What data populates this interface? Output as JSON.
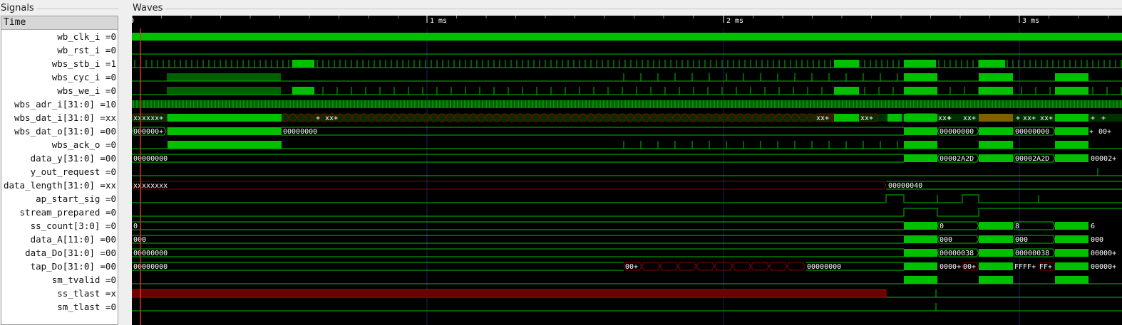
{
  "panels": {
    "signals_title": "Signals",
    "waves_title": "Waves"
  },
  "signals": {
    "header": "Time",
    "rows": [
      "wb_clk_i =0",
      "wb_rst_i =0",
      "wbs_stb_i =1",
      "wbs_cyc_i =0",
      "wbs_we_i =0",
      "wbs_adr_i[31:0] =10",
      "wbs_dat_i[31:0] =xx",
      "wbs_dat_o[31:0] =00",
      "wbs_ack_o =0",
      "data_y[31:0] =00",
      "y_out_request =0",
      "data_length[31:0] =xx",
      "ap_start_sig =0",
      "stream_prepared =0",
      "ss_count[3:0] =0",
      "data_A[11:0] =00",
      "data_Do[31:0] =00",
      "tap_Do[31:0] =00",
      "sm_tvalid =0",
      "ss_tlast =x",
      "sm_tlast =0"
    ]
  },
  "timeline": {
    "ticks": [
      "0",
      "1 ms",
      "2 ms",
      "3 ms"
    ]
  },
  "colors": {
    "wave_green": "#00c000",
    "wave_bg": "#000000",
    "grid": "#1e1e5a",
    "undef_red": "#8b0000",
    "cursor": "#e03020"
  },
  "values": {
    "wbs_dat_i_labels": [
      "xxxxxx+",
      "+",
      "xx+",
      "+",
      "xx+",
      "xx+",
      "+",
      "xx+",
      "+",
      "xx+",
      "xx+",
      "+",
      "xx+",
      "xx+",
      "+",
      "+"
    ],
    "wbs_dat_o_labels": [
      "000000+",
      "00000000",
      "00000000",
      "00000000",
      "+",
      "00+"
    ],
    "data_y_labels": [
      "00000000",
      "00002A2D",
      "00002A2D",
      "00002+"
    ],
    "data_length_labels": [
      "xxxxxxxx",
      "00000040"
    ],
    "ss_count_labels": [
      "0",
      "0",
      "8",
      "6"
    ],
    "data_A_labels": [
      "000",
      "000",
      "000",
      "000"
    ],
    "data_Do_labels": [
      "00000000",
      "00000038",
      "00000038",
      "00000+"
    ],
    "tap_Do_labels": [
      "00000000",
      "00+",
      "00000000",
      "0000+",
      "00+",
      "FFFF+",
      "FF+",
      "00000+"
    ]
  }
}
